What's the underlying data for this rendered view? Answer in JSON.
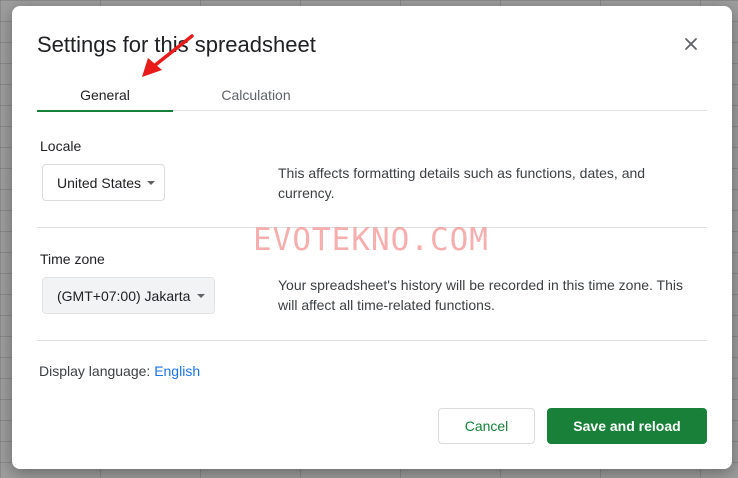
{
  "dialog": {
    "title": "Settings for this spreadsheet",
    "close_icon": "close-icon"
  },
  "tabs": [
    {
      "label": "General",
      "active": true
    },
    {
      "label": "Calculation",
      "active": false
    }
  ],
  "locale": {
    "label": "Locale",
    "value": "United States",
    "description": "This affects formatting details such as functions, dates, and currency."
  },
  "timezone": {
    "label": "Time zone",
    "value": "(GMT+07:00) Jakarta",
    "description": "Your spreadsheet's history will be recorded in this time zone. This will affect all time-related functions."
  },
  "display_language": {
    "label": "Display language:",
    "value": "English"
  },
  "buttons": {
    "cancel": "Cancel",
    "save": "Save and reload"
  },
  "watermark": "EVOTEKNO.COM",
  "colors": {
    "accent": "#188038",
    "link": "#1a73e8",
    "arrow": "#e81a1a"
  }
}
